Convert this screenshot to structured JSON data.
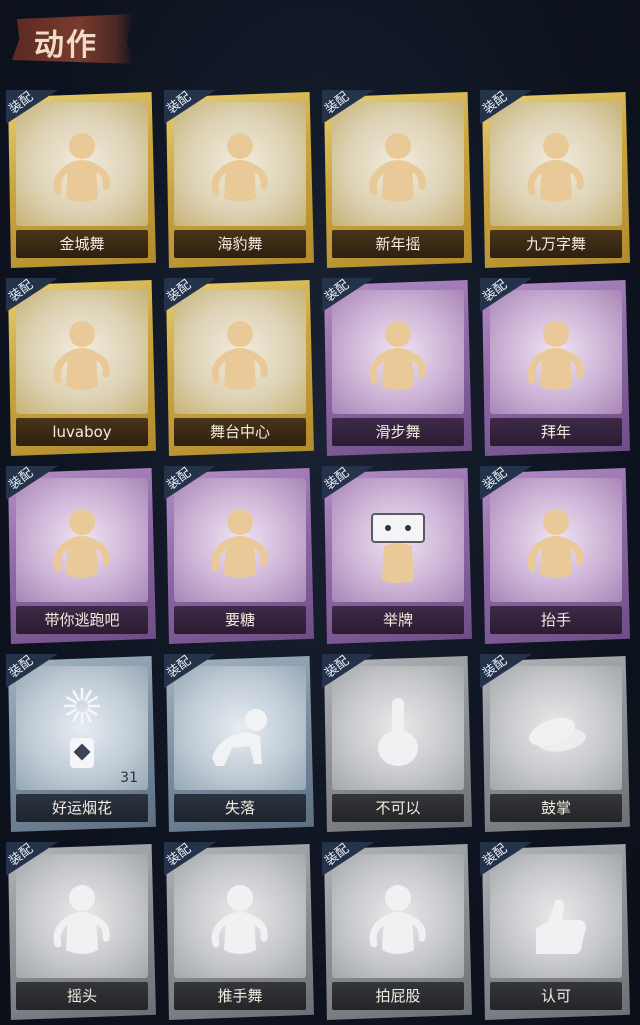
{
  "header": {
    "title": "动作"
  },
  "badge_label": "装配",
  "cards": [
    {
      "label": "金城舞",
      "rarity": "gold",
      "icon": "dance-figure-icon"
    },
    {
      "label": "海豹舞",
      "rarity": "gold",
      "icon": "dance-figure-icon"
    },
    {
      "label": "新年摇",
      "rarity": "gold",
      "icon": "dance-figure-icon"
    },
    {
      "label": "九万字舞",
      "rarity": "gold",
      "icon": "dance-figure-icon"
    },
    {
      "label": "luvaboy",
      "rarity": "gold",
      "icon": "dance-figure-icon"
    },
    {
      "label": "舞台中心",
      "rarity": "gold",
      "icon": "dance-figure-icon"
    },
    {
      "label": "滑步舞",
      "rarity": "purple",
      "icon": "dance-figure-icon"
    },
    {
      "label": "拜年",
      "rarity": "purple",
      "icon": "greeting-figure-icon"
    },
    {
      "label": "带你逃跑吧",
      "rarity": "purple",
      "icon": "dance-figure-icon"
    },
    {
      "label": "要糖",
      "rarity": "purple",
      "icon": "reach-figure-icon"
    },
    {
      "label": "举牌",
      "rarity": "purple",
      "icon": "sign-figure-icon"
    },
    {
      "label": "抬手",
      "rarity": "purple",
      "icon": "wave-figure-icon"
    },
    {
      "label": "好运烟花",
      "rarity": "blue",
      "icon": "firework-icon",
      "count": "31"
    },
    {
      "label": "失落",
      "rarity": "blue",
      "icon": "crawl-figure-icon"
    },
    {
      "label": "不可以",
      "rarity": "gray",
      "icon": "finger-wag-icon"
    },
    {
      "label": "鼓掌",
      "rarity": "gray",
      "icon": "clap-hands-icon"
    },
    {
      "label": "摇头",
      "rarity": "gray",
      "icon": "shake-figure-icon"
    },
    {
      "label": "推手舞",
      "rarity": "gray",
      "icon": "dance-figure-icon"
    },
    {
      "label": "拍屁股",
      "rarity": "gray",
      "icon": "pat-figure-icon"
    },
    {
      "label": "认可",
      "rarity": "gray",
      "icon": "thumbs-up-icon"
    }
  ]
}
